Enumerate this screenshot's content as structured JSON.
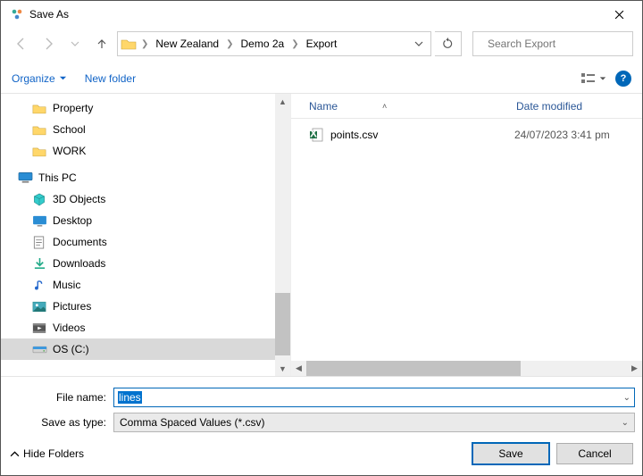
{
  "window": {
    "title": "Save As"
  },
  "nav": {
    "breadcrumbs": [
      "New Zealand",
      "Demo 2a",
      "Export"
    ],
    "search_placeholder": "Search Export"
  },
  "toolbar": {
    "organize": "Organize",
    "new_folder": "New folder"
  },
  "tree": {
    "quick": [
      {
        "label": "Property"
      },
      {
        "label": "School"
      },
      {
        "label": "WORK"
      }
    ],
    "this_pc_label": "This PC",
    "this_pc": [
      {
        "label": "3D Objects",
        "icon": "3d"
      },
      {
        "label": "Desktop",
        "icon": "desktop"
      },
      {
        "label": "Documents",
        "icon": "doc"
      },
      {
        "label": "Downloads",
        "icon": "down"
      },
      {
        "label": "Music",
        "icon": "music"
      },
      {
        "label": "Pictures",
        "icon": "pic"
      },
      {
        "label": "Videos",
        "icon": "vid"
      },
      {
        "label": "OS (C:)",
        "icon": "drive",
        "selected": true
      }
    ]
  },
  "files": {
    "columns": {
      "name": "Name",
      "date": "Date modified"
    },
    "rows": [
      {
        "name": "points.csv",
        "date": "24/07/2023 3:41 pm"
      }
    ]
  },
  "form": {
    "filename_label": "File name:",
    "filename_value": "lines",
    "type_label": "Save as type:",
    "type_value": "Comma Spaced Values (*.csv)"
  },
  "footer": {
    "hide_folders": "Hide Folders",
    "save": "Save",
    "cancel": "Cancel"
  }
}
